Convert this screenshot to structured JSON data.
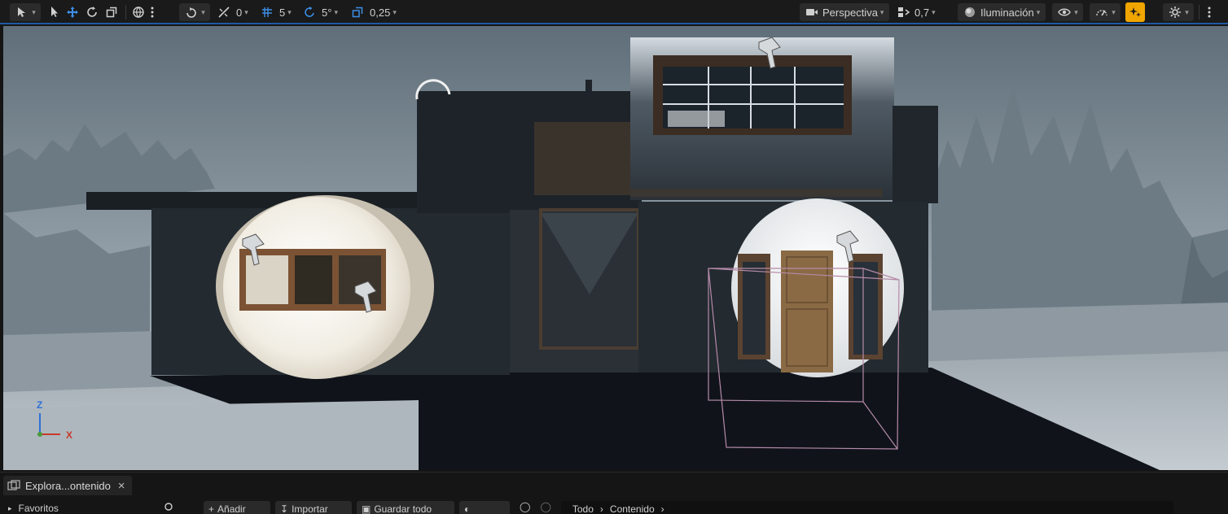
{
  "toolbar": {
    "snap_translate_value": "0",
    "grid_value": "5",
    "rotation_value": "5°",
    "scale_value": "0,25",
    "view_mode": "Perspectiva",
    "camera_speed": "0,7",
    "lighting_mode": "Iluminación"
  },
  "viewport": {
    "axis_z": "Z",
    "axis_x": "X"
  },
  "bottom": {
    "tab_label": "Explora...ontenido",
    "close_symbol": "×",
    "row": {
      "favorites": "Favoritos",
      "add": "Añadir",
      "import": "Importar",
      "save_all": "Guardar todo",
      "path_all": "Todo",
      "path_content": "Contenido"
    }
  },
  "colors": {
    "accent_blue": "#1d5aa0",
    "realtime_badge": "#f0a500"
  }
}
